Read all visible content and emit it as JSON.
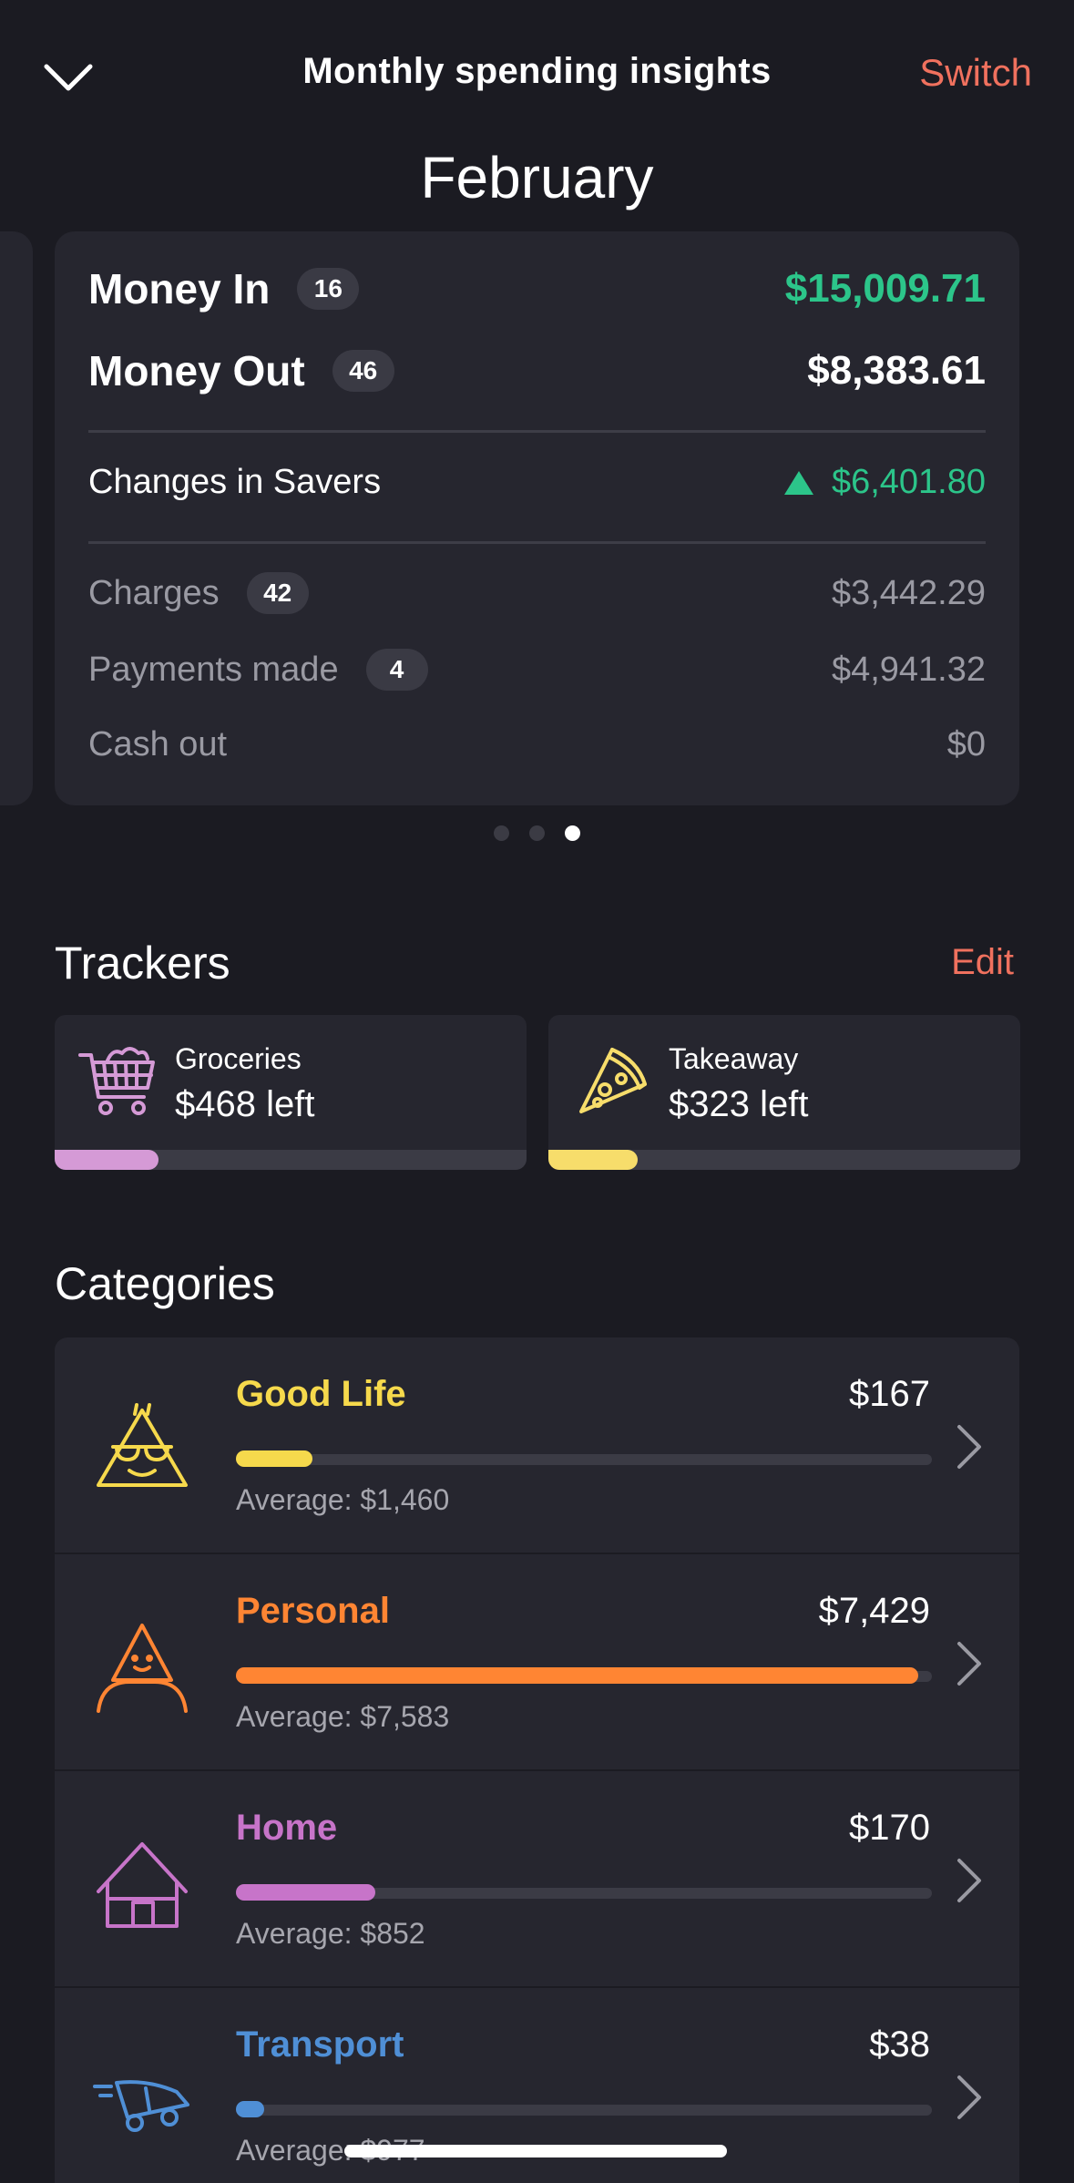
{
  "header": {
    "title": "Monthly spending insights",
    "switch_label": "Switch",
    "month": "February"
  },
  "summary": {
    "money_in": {
      "label": "Money In",
      "count": "16",
      "value": "$15,009.71"
    },
    "money_out": {
      "label": "Money Out",
      "count": "46",
      "value": "$8,383.61"
    },
    "savers": {
      "label": "Changes in Savers",
      "value": "$6,401.80"
    },
    "charges": {
      "label": "Charges",
      "count": "42",
      "value": "$3,442.29"
    },
    "payments": {
      "label": "Payments made",
      "count": "4",
      "value": "$4,941.32"
    },
    "cash_out": {
      "label": "Cash out",
      "value": "$0"
    },
    "pager": {
      "pages": 3,
      "active": 3
    }
  },
  "trackers": {
    "title": "Trackers",
    "edit_label": "Edit",
    "items": [
      {
        "name": "Groceries",
        "left": "$468 left",
        "icon": "shopping-cart-icon",
        "color": "#d59ad6",
        "progress": 0.22
      },
      {
        "name": "Takeaway",
        "left": "$323 left",
        "icon": "pizza-icon",
        "color": "#f7dd6b",
        "progress": 0.19
      }
    ]
  },
  "categories": {
    "title": "Categories",
    "items": [
      {
        "name": "Good Life",
        "amount": "$167",
        "average": "Average: $1,460",
        "color": "#f6d94c",
        "icon": "sunglasses-triangle-icon",
        "progress": 0.11
      },
      {
        "name": "Personal",
        "amount": "$7,429",
        "average": "Average: $7,583",
        "color": "#ff8533",
        "icon": "person-triangle-icon",
        "progress": 0.98
      },
      {
        "name": "Home",
        "amount": "$170",
        "average": "Average: $852",
        "color": "#c774c9",
        "icon": "house-icon",
        "progress": 0.2
      },
      {
        "name": "Transport",
        "amount": "$38",
        "average": "Average: $977",
        "color": "#4f8fd6",
        "icon": "moving-car-icon",
        "progress": 0.04
      }
    ]
  }
}
